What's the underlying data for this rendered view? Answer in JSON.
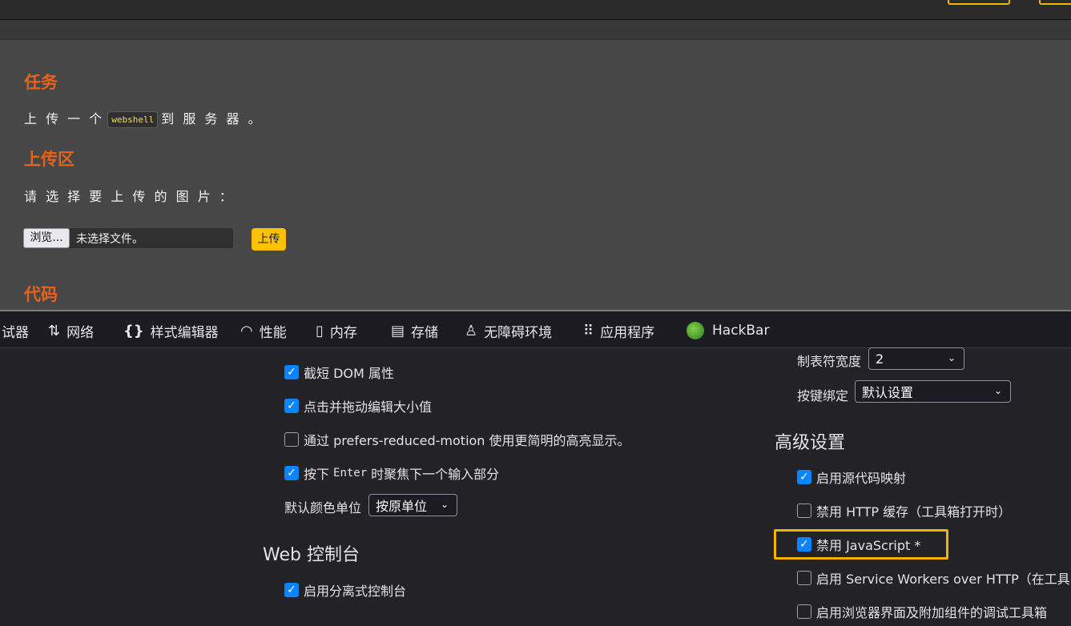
{
  "page": {
    "task_heading": "任务",
    "task_text_before": "上 传 一 个",
    "task_code": "webshell",
    "task_text_after": "到 服 务 器 。",
    "upload_heading": "上传区",
    "select_prompt": "请 选 择 要 上 传 的 图 片 ：",
    "browse_label": "浏览...",
    "file_status": "未选择文件。",
    "upload_label": "上传",
    "code_heading": "代码"
  },
  "toolbar": {
    "tabs": [
      {
        "label": "试器",
        "icon": "debugger-icon"
      },
      {
        "label": "网络",
        "icon": "network-icon"
      },
      {
        "label": "样式编辑器",
        "icon": "braces-icon"
      },
      {
        "label": "性能",
        "icon": "gauge-icon"
      },
      {
        "label": "内存",
        "icon": "chip-icon"
      },
      {
        "label": "存储",
        "icon": "storage-icon"
      },
      {
        "label": "无障碍环境",
        "icon": "accessibility-icon"
      },
      {
        "label": "应用程序",
        "icon": "grid-icon"
      },
      {
        "label": "HackBar",
        "icon": "hackbar-icon"
      }
    ]
  },
  "settings": {
    "inspector": {
      "truncate_dom": {
        "label": "截短 DOM 属性",
        "checked": true
      },
      "drag_edit": {
        "label": "点击并拖动编辑大小值",
        "checked": true
      },
      "reduced_motion": {
        "label": "通过 prefers-reduced-motion 使用更简明的高亮显示。",
        "checked": false
      },
      "enter_focus": {
        "label_pre": "按下",
        "label_key": "Enter",
        "label_post": "时聚焦下一个输入部分",
        "checked": true
      },
      "default_color_unit_label": "默认颜色单位",
      "default_color_unit_value": "按原单位"
    },
    "web_console": {
      "title": "Web 控制台",
      "split_console": {
        "label": "启用分离式控制台",
        "checked": true
      }
    },
    "editor": {
      "tab_size_label": "制表符宽度",
      "tab_size_value": "2",
      "keybinding_label": "按键绑定",
      "keybinding_value": "默认设置"
    },
    "advanced": {
      "title": "高级设置",
      "source_maps": {
        "label": "启用源代码映射",
        "checked": true
      },
      "disable_cache": {
        "label": "禁用 HTTP 缓存（工具箱打开时）",
        "checked": false
      },
      "disable_js": {
        "label": "禁用 JavaScript *",
        "checked": true
      },
      "service_workers": {
        "label": "启用 Service Workers over HTTP（在工具",
        "checked": false
      },
      "browser_toolbox": {
        "label": "启用浏览器界面及附加组件的调试工具箱",
        "checked": false
      }
    }
  },
  "colors": {
    "accent": "#0a84ff",
    "heading_orange": "#e8631a",
    "highlight": "#f2b400"
  }
}
